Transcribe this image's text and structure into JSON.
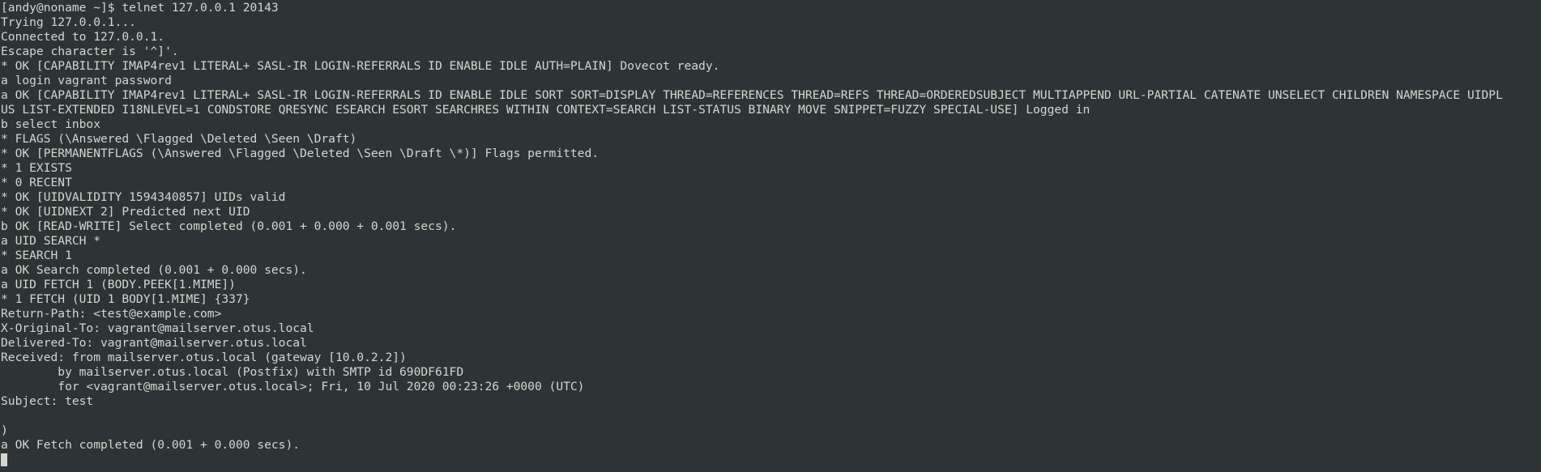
{
  "terminal": {
    "lines": [
      "[andy@noname ~]$ telnet 127.0.0.1 20143",
      "Trying 127.0.0.1...",
      "Connected to 127.0.0.1.",
      "Escape character is '^]'.",
      "* OK [CAPABILITY IMAP4rev1 LITERAL+ SASL-IR LOGIN-REFERRALS ID ENABLE IDLE AUTH=PLAIN] Dovecot ready.",
      "a login vagrant password",
      "a OK [CAPABILITY IMAP4rev1 LITERAL+ SASL-IR LOGIN-REFERRALS ID ENABLE IDLE SORT SORT=DISPLAY THREAD=REFERENCES THREAD=REFS THREAD=ORDEREDSUBJECT MULTIAPPEND URL-PARTIAL CATENATE UNSELECT CHILDREN NAMESPACE UIDPL",
      "US LIST-EXTENDED I18NLEVEL=1 CONDSTORE QRESYNC ESEARCH ESORT SEARCHRES WITHIN CONTEXT=SEARCH LIST-STATUS BINARY MOVE SNIPPET=FUZZY SPECIAL-USE] Logged in",
      "b select inbox",
      "* FLAGS (\\Answered \\Flagged \\Deleted \\Seen \\Draft)",
      "* OK [PERMANENTFLAGS (\\Answered \\Flagged \\Deleted \\Seen \\Draft \\*)] Flags permitted.",
      "* 1 EXISTS",
      "* 0 RECENT",
      "* OK [UIDVALIDITY 1594340857] UIDs valid",
      "* OK [UIDNEXT 2] Predicted next UID",
      "b OK [READ-WRITE] Select completed (0.001 + 0.000 + 0.001 secs).",
      "a UID SEARCH *",
      "* SEARCH 1",
      "a OK Search completed (0.001 + 0.000 secs).",
      "a UID FETCH 1 (BODY.PEEK[1.MIME])",
      "* 1 FETCH (UID 1 BODY[1.MIME] {337}",
      "Return-Path: <test@example.com>",
      "X-Original-To: vagrant@mailserver.otus.local",
      "Delivered-To: vagrant@mailserver.otus.local",
      "Received: from mailserver.otus.local (gateway [10.0.2.2])",
      "        by mailserver.otus.local (Postfix) with SMTP id 690DF61FD",
      "        for <vagrant@mailserver.otus.local>; Fri, 10 Jul 2020 00:23:26 +0000 (UTC)",
      "Subject: test",
      "",
      ")",
      "a OK Fetch completed (0.001 + 0.000 secs)."
    ]
  },
  "colors": {
    "background": "#2e3436",
    "foreground": "#d3d7cf"
  }
}
